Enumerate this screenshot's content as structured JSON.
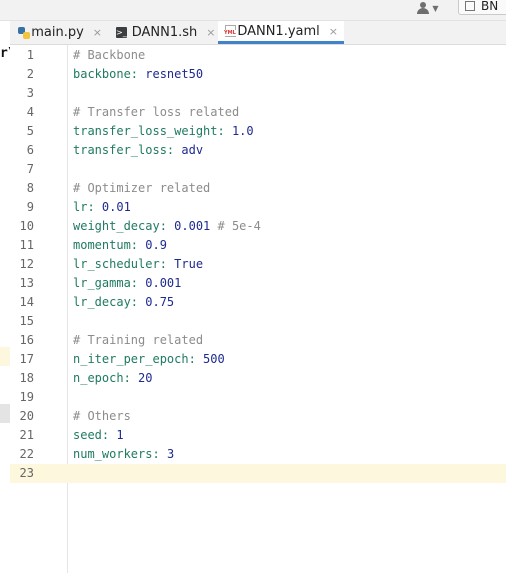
{
  "toolbar": {
    "run_config_label": "BN"
  },
  "tabs": [
    {
      "label": "main.py",
      "icon": "python-file-icon",
      "active": false
    },
    {
      "label": "DANN1.sh",
      "icon": "shell-file-icon",
      "active": false
    },
    {
      "label": "DANN1.yaml",
      "icon": "yaml-file-icon",
      "active": true
    }
  ],
  "tab_close_glyph": "×",
  "left_panel_label": "r\\",
  "yaml_badge": "YML",
  "shell_badge": ">_",
  "current_line": 23,
  "lines": [
    {
      "n": "1",
      "comment": "# Backbone"
    },
    {
      "n": "2",
      "key": "backbone",
      "value": "resnet50"
    },
    {
      "n": "3"
    },
    {
      "n": "4",
      "comment": "# Transfer loss related"
    },
    {
      "n": "5",
      "key": "transfer_loss_weight",
      "value": "1.0"
    },
    {
      "n": "6",
      "key": "transfer_loss",
      "value": "adv"
    },
    {
      "n": "7"
    },
    {
      "n": "8",
      "comment": "# Optimizer related"
    },
    {
      "n": "9",
      "key": "lr",
      "value": "0.01"
    },
    {
      "n": "10",
      "key": "weight_decay",
      "value": "0.001",
      "trail": " # 5e-4"
    },
    {
      "n": "11",
      "key": "momentum",
      "value": "0.9"
    },
    {
      "n": "12",
      "key": "lr_scheduler",
      "value": "True"
    },
    {
      "n": "13",
      "key": "lr_gamma",
      "value": "0.001"
    },
    {
      "n": "14",
      "key": "lr_decay",
      "value": "0.75"
    },
    {
      "n": "15"
    },
    {
      "n": "16",
      "comment": "# Training related"
    },
    {
      "n": "17",
      "key": "n_iter_per_epoch",
      "value": "500"
    },
    {
      "n": "18",
      "key": "n_epoch",
      "value": "20"
    },
    {
      "n": "19"
    },
    {
      "n": "20",
      "comment": "# Others"
    },
    {
      "n": "21",
      "key": "seed",
      "value": "1"
    },
    {
      "n": "22",
      "key": "num_workers",
      "value": "3"
    },
    {
      "n": "23"
    }
  ],
  "colors": {
    "key": "#1f7a62",
    "value": "#1d2a8f",
    "comment": "#8c8c8c",
    "current_line": "#fdf7dd",
    "active_tab_underline": "#4083c9"
  }
}
